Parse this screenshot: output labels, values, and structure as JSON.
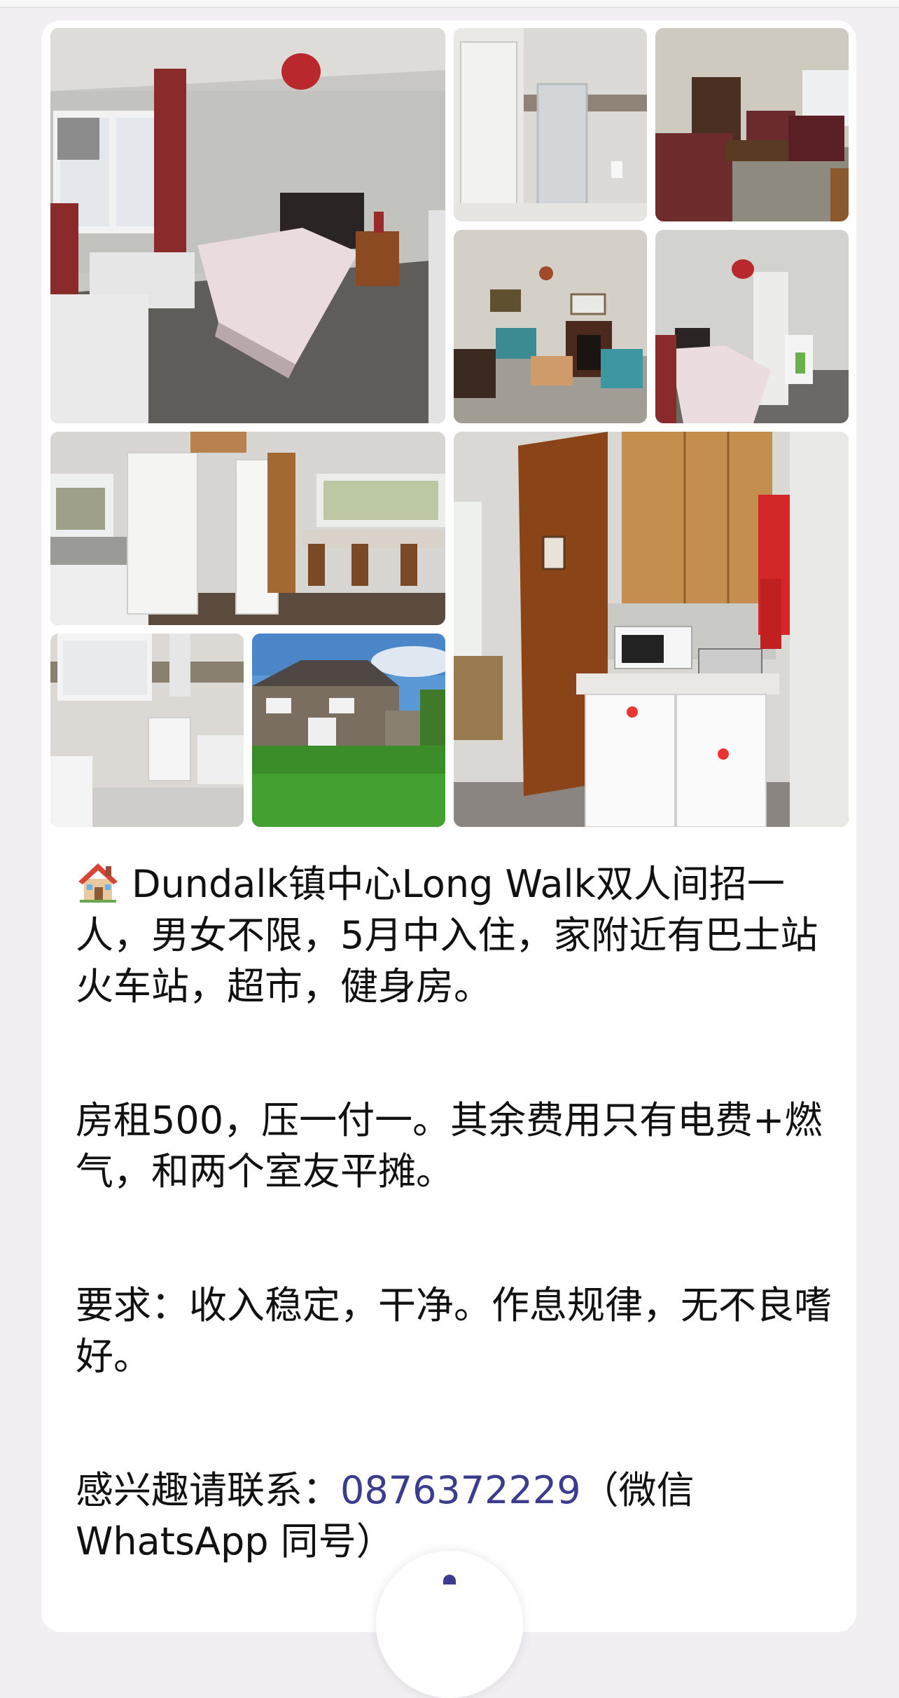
{
  "post": {
    "photos": [
      {
        "name": "bedroom-photo"
      },
      {
        "name": "shower-room-photo"
      },
      {
        "name": "sitting-room-photo"
      },
      {
        "name": "living-room-fireplace-photo"
      },
      {
        "name": "bedroom-second-view-photo"
      },
      {
        "name": "kitchen-dining-photo"
      },
      {
        "name": "kitchen-appliances-photo"
      },
      {
        "name": "bathroom-photo"
      },
      {
        "name": "house-exterior-garden-photo"
      }
    ],
    "house_icon": "house-emoji-icon",
    "paragraph1": "Dundalk镇中心Long Walk双人间招一人，男女不限，5月中入住，家附近有巴士站火车站，超市，健身房。",
    "paragraph2": "房租500，压一付一。其余费用只有电费+燃气，和两个室友平摊。",
    "paragraph3": "要求：收入稳定，干净。作息规律，无不良嗜好。",
    "contact_prefix": "感兴趣请联系：",
    "contact_phone": "0876372229",
    "contact_suffix": "（微信 WhatsApp 同号）"
  },
  "colors": {
    "link": "#3c3c8e",
    "background": "#f1eff2",
    "card": "#ffffff"
  }
}
